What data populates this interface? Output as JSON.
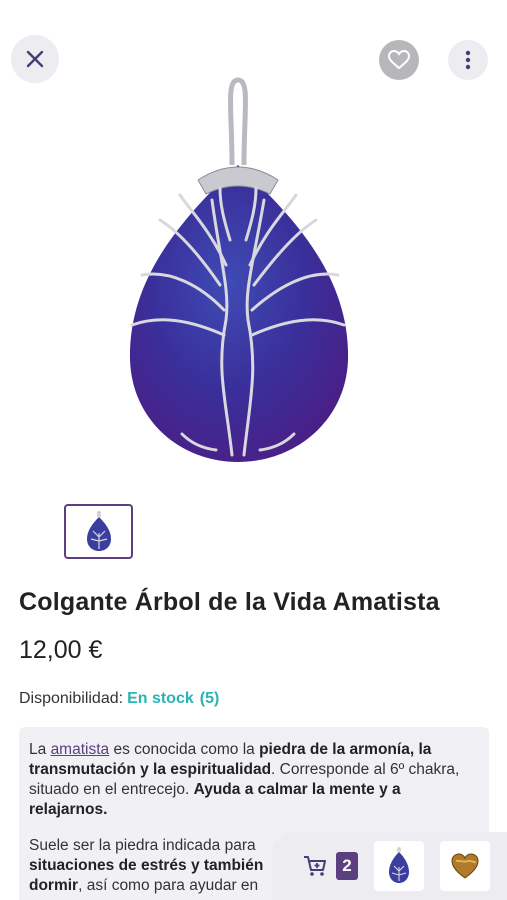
{
  "header": {
    "close_icon": "close-icon",
    "favorite_icon": "heart-icon",
    "more_icon": "more-vertical-icon"
  },
  "product": {
    "title": "Colgante Árbol de la Vida Amatista",
    "price": "12,00 €",
    "availability_label": "Disponibilidad:",
    "availability_status": "En stock",
    "availability_count": "(5)"
  },
  "description": {
    "p1": {
      "t1": "La ",
      "link": "amatista",
      "t2": " es conocida como la ",
      "b1": "piedra de la armonía, la transmutación y la espiritualidad",
      "t3": ". Corresponde al 6º chakra, situado en el entrecejo. ",
      "b2": "Ayuda a calmar la mente y a relajarnos."
    },
    "p2": {
      "t1": "Suele ser la piedra indicada para",
      "b1": "situaciones de estrés y también",
      "b2": "dormir",
      "t2": ", así como para ayudar en"
    }
  },
  "cart": {
    "icon": "cart-add-icon",
    "count": "2"
  },
  "colors": {
    "accent": "#5c3f7f",
    "stock": "#2bb3b3",
    "amethyst": "#4a2f8f"
  }
}
